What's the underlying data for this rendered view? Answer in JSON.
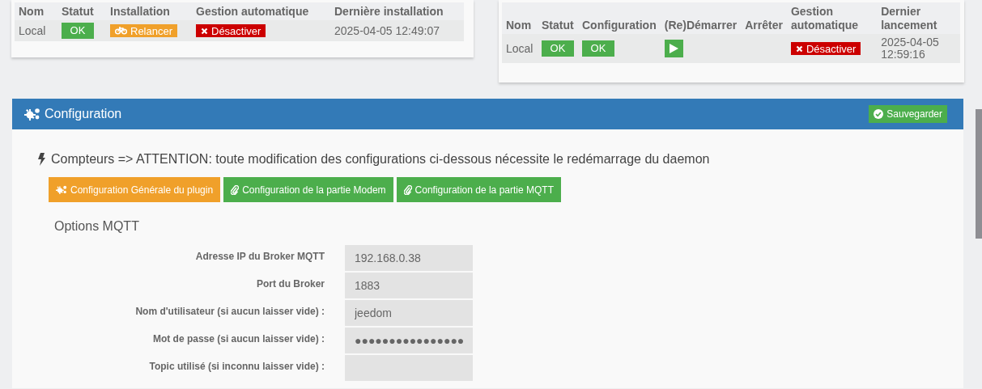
{
  "install_table": {
    "columns": [
      "Nom",
      "Statut",
      "Installation",
      "Gestion automatique",
      "Dernière installation"
    ],
    "rows": [
      {
        "cells": [
          {
            "kind": "text",
            "text": "Local"
          },
          {
            "kind": "status",
            "label": "OK"
          },
          {
            "kind": "relaunch",
            "label": "Relancer"
          },
          {
            "kind": "disable",
            "label": "Désactiver"
          },
          {
            "kind": "text",
            "text": "2025-04-05 12:49:07"
          }
        ]
      }
    ]
  },
  "daemon_table": {
    "columns": [
      "Nom",
      "Statut",
      "Configuration",
      "(Re)Démarrer",
      "Arrêter",
      "Gestion automatique",
      "Dernier lancement"
    ],
    "rows": [
      {
        "cells": [
          {
            "kind": "text",
            "text": "Local"
          },
          {
            "kind": "status",
            "label": "OK"
          },
          {
            "kind": "status",
            "label": "OK"
          },
          {
            "kind": "start"
          },
          {
            "kind": "empty"
          },
          {
            "kind": "disable",
            "label": "Désactiver"
          },
          {
            "kind": "text",
            "text": "2025-04-05 12:59:16"
          }
        ]
      }
    ]
  },
  "configuration": {
    "title": "Configuration",
    "save_button": "Sauvegarder",
    "warning": "Compteurs => ATTENTION: toute modification des configurations ci-dessous nécessite le redémarrage du daemon",
    "tabs": [
      {
        "kind": "general",
        "label": "Configuration Générale du plugin"
      },
      {
        "kind": "part",
        "label": "Configuration de la partie Modem"
      },
      {
        "kind": "part",
        "label": "Configuration de la partie MQTT"
      }
    ],
    "section_title": "Options MQTT",
    "fields": [
      {
        "label": "Adresse IP du Broker MQTT",
        "value": "192.168.0.38"
      },
      {
        "label": "Port du Broker",
        "value": "1883"
      },
      {
        "label": "Nom d'utilisateur (si aucun laisser vide) :",
        "value": "jeedom"
      },
      {
        "label": "Mot de passe (si aucun laisser vide) :",
        "value": "●●●●●●●●●●●●●●●●"
      },
      {
        "label": "Topic utilisé (si inconnu laisser vide) :"
      }
    ]
  }
}
